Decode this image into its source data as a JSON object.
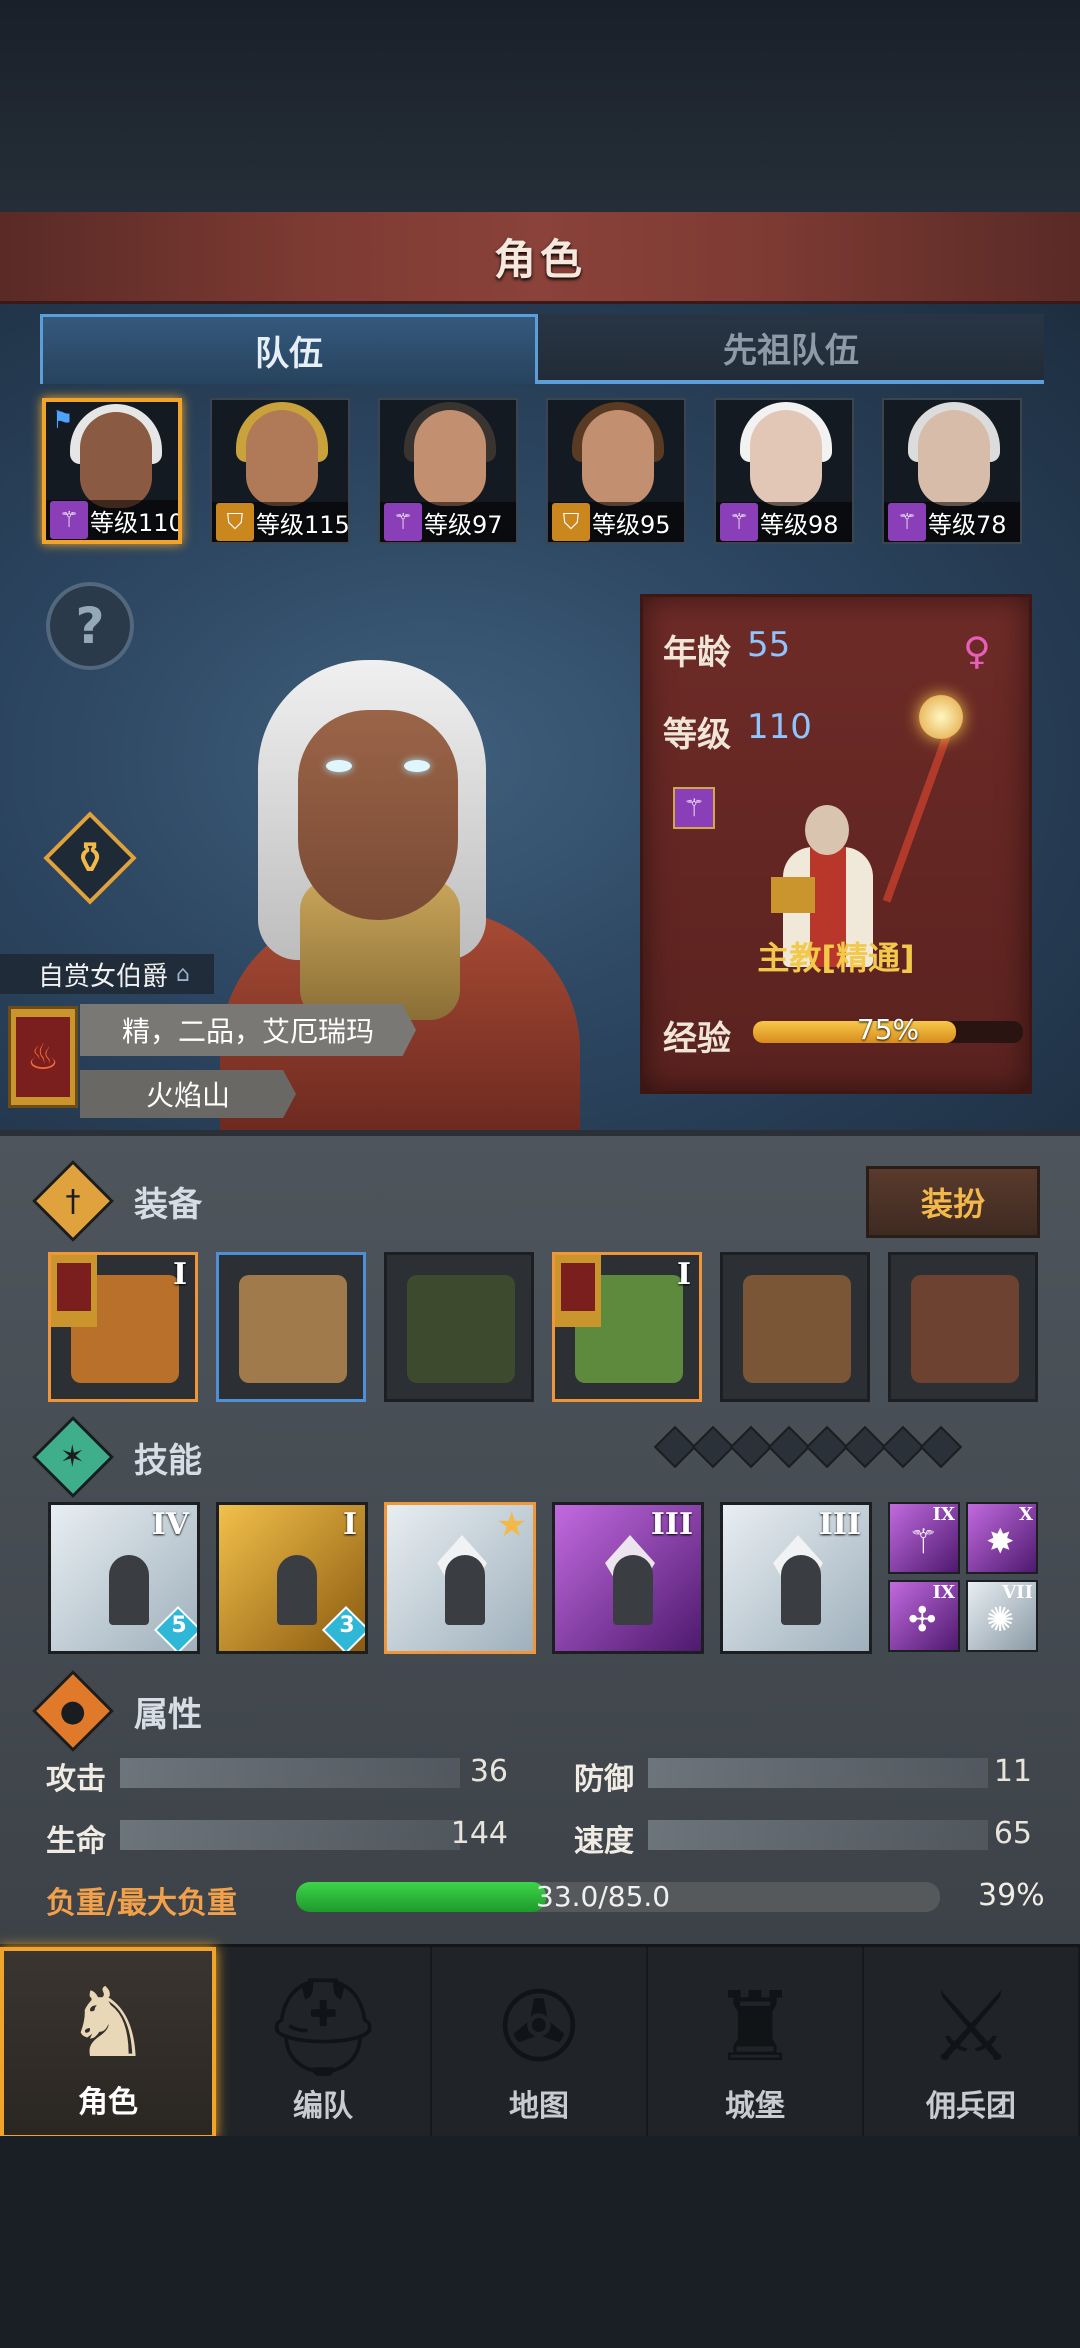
{
  "header": {
    "title": "角色"
  },
  "tabs": [
    {
      "label": "队伍",
      "active": true
    },
    {
      "label": "先祖队伍",
      "active": false
    }
  ],
  "party": [
    {
      "level_text": "等级110",
      "class_icon": "staff-icon",
      "class_color": "purple",
      "selected": true,
      "skin": "#8a5a42",
      "hair": "#e6e6e6"
    },
    {
      "level_text": "等级115",
      "class_icon": "shield-icon",
      "class_color": "gold",
      "selected": false,
      "skin": "#b07a58",
      "hair": "#c9a23c"
    },
    {
      "level_text": "等级97",
      "class_icon": "staff-icon",
      "class_color": "purple",
      "selected": false,
      "skin": "#c28f70",
      "hair": "#3a3430"
    },
    {
      "level_text": "等级95",
      "class_icon": "shield-icon",
      "class_color": "gold",
      "selected": false,
      "skin": "#c28f70",
      "hair": "#5a3a22"
    },
    {
      "level_text": "等级98",
      "class_icon": "staff-icon",
      "class_color": "purple",
      "selected": false,
      "skin": "#e2c6b6",
      "hair": "#f2f2f2"
    },
    {
      "level_text": "等级78",
      "class_icon": "staff-icon",
      "class_color": "purple",
      "selected": false,
      "skin": "#d8bcaa",
      "hair": "#dcdcdc"
    }
  ],
  "character": {
    "age_label": "年龄",
    "age": "55",
    "level_label": "等级",
    "level": "110",
    "gender_icon": "female-icon",
    "class_title": "主教[精通]",
    "exp_label": "经验",
    "exp_text": "75%",
    "exp_fraction": 0.75,
    "noble_title": "自赏女伯爵",
    "name": "精，二品，艾厄瑞玛",
    "homeland": "火焰山"
  },
  "equipment": {
    "title": "装备",
    "dress_button": "装扮",
    "slots": [
      {
        "name": "dragon-weapon",
        "tier": "I",
        "border": "orange",
        "color": "#b8702a",
        "badge": true
      },
      {
        "name": "wooden-shield",
        "tier": "",
        "border": "blue",
        "color": "#a07a4a",
        "badge": false
      },
      {
        "name": "hood",
        "tier": "",
        "border": "none",
        "color": "#3e4a2e",
        "badge": false
      },
      {
        "name": "green-armor",
        "tier": "I",
        "border": "orange",
        "color": "#5e8a3e",
        "badge": true
      },
      {
        "name": "leather-boots",
        "tier": "",
        "border": "none",
        "color": "#7a5636",
        "badge": false
      },
      {
        "name": "tome",
        "tier": "",
        "border": "none",
        "color": "#6e4230",
        "badge": false
      }
    ]
  },
  "skills": {
    "title": "技能",
    "items": [
      {
        "tier": "IV",
        "color": "white",
        "gem": "5",
        "art": "figure",
        "border": "none",
        "star": false
      },
      {
        "tier": "I",
        "color": "gold",
        "gem": "3",
        "art": "figure",
        "border": "none",
        "star": false
      },
      {
        "tier": "",
        "color": "white",
        "gem": "",
        "art": "crystal",
        "border": "orange",
        "star": true
      },
      {
        "tier": "III",
        "color": "purple",
        "gem": "",
        "art": "crystal",
        "border": "none",
        "star": false
      },
      {
        "tier": "III",
        "color": "white",
        "gem": "",
        "art": "crystal",
        "border": "none",
        "star": false
      }
    ],
    "mini": [
      {
        "tier": "IX",
        "color": "purple",
        "glyph": "⚚"
      },
      {
        "tier": "X",
        "color": "purple",
        "glyph": "✸"
      },
      {
        "tier": "IX",
        "color": "purple",
        "glyph": "✣"
      },
      {
        "tier": "VII",
        "color": "white",
        "glyph": "✺"
      }
    ]
  },
  "attributes": {
    "title": "属性",
    "attack_label": "攻击",
    "attack": "36",
    "defense_label": "防御",
    "defense": "11",
    "hp_label": "生命",
    "hp": "144",
    "speed_label": "速度",
    "speed": "65",
    "load_label": "负重/最大负重",
    "load_text": "33.0/85.0",
    "load_fraction": 0.388,
    "load_pct": "39%"
  },
  "nav": [
    {
      "label": "角色",
      "icon": "knight-icon",
      "active": true
    },
    {
      "label": "编队",
      "icon": "helmet-icon",
      "active": false
    },
    {
      "label": "地图",
      "icon": "compass-map-icon",
      "active": false
    },
    {
      "label": "城堡",
      "icon": "castle-icon",
      "active": false
    },
    {
      "label": "佣兵团",
      "icon": "mercenary-icon",
      "active": false
    }
  ],
  "colors": {
    "accent": "#f0a52a",
    "tab_blue": "#5c9fd8",
    "panel_red": "#6e2b27",
    "load_green": "#3dd44a"
  }
}
